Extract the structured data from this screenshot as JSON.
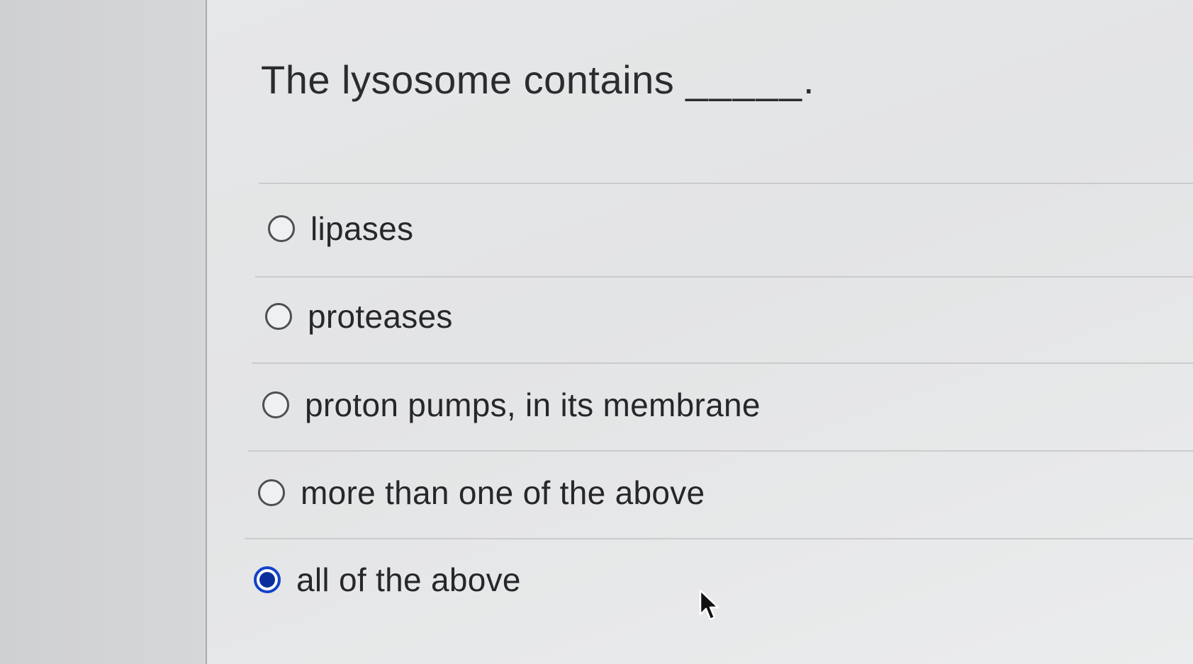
{
  "question": {
    "text": "The lysosome contains",
    "blank": "_____."
  },
  "options": [
    {
      "label": "lipases",
      "selected": false
    },
    {
      "label": "proteases",
      "selected": false
    },
    {
      "label": "proton pumps, in its membrane",
      "selected": false
    },
    {
      "label": "more than one of the above",
      "selected": false
    },
    {
      "label": "all of the above",
      "selected": true
    }
  ],
  "colors": {
    "selected_radio": "#1342c9",
    "text": "#26272b"
  },
  "icons": {
    "cursor": "mouse-pointer-icon"
  }
}
